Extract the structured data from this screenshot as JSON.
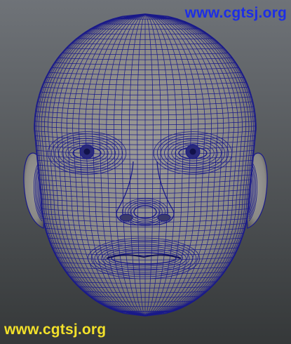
{
  "viewport": {
    "background_top": "#6f7378",
    "background_bottom": "#353839",
    "mesh_fill": "#8f8e8b",
    "mesh_shadow": "#5d5c5a",
    "wire_color": "#1a1a8a"
  },
  "watermarks": {
    "top": {
      "text": "www.cgtsj.org",
      "color": "#1d2ee6"
    },
    "bottom": {
      "text": "www.cgtsj.org",
      "color": "#f2e12a"
    }
  }
}
